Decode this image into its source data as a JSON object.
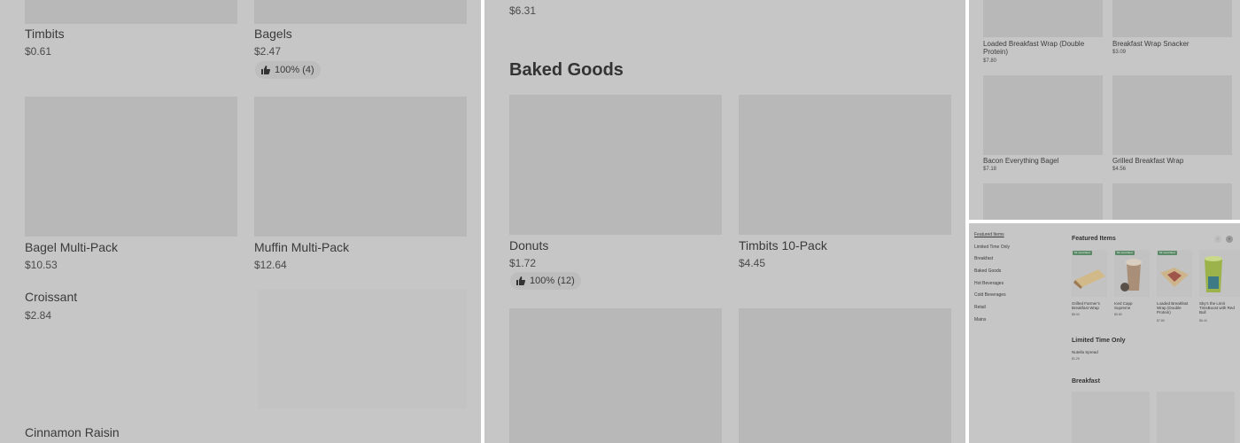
{
  "panel1": {
    "items": [
      {
        "name": "Timbits",
        "price": "$0.61"
      },
      {
        "name": "Bagels",
        "price": "$2.47",
        "rating": "100% (4)"
      },
      {
        "name": "Bagel Multi-Pack",
        "price": "$10.53"
      },
      {
        "name": "Muffin Multi-Pack",
        "price": "$12.64"
      },
      {
        "name": "Croissant",
        "price": "$2.84"
      },
      {
        "name": "Cinnamon Raisin"
      }
    ]
  },
  "panel2": {
    "top_price": "$6.31",
    "section_title": "Baked Goods",
    "items": [
      {
        "name": "Donuts",
        "price": "$1.72",
        "rating": "100% (12)"
      },
      {
        "name": "Timbits 10-Pack",
        "price": "$4.45"
      }
    ]
  },
  "panel3": {
    "items": [
      {
        "name": "Loaded Breakfast Wrap (Double Protein)",
        "price": "$7.80"
      },
      {
        "name": "Breakfast Wrap Snacker",
        "price": "$3.09"
      },
      {
        "name": "Bacon Everything Bagel",
        "price": "$7.18"
      },
      {
        "name": "Grilled Breakfast Wrap",
        "price": "$4.56"
      }
    ]
  },
  "panel4": {
    "nav": [
      "Featured Items",
      "Limited Time Only",
      "Breakfast",
      "Baked Goods",
      "Hot Beverages",
      "Cold Beverages",
      "Retail",
      "Mains"
    ],
    "featured_title": "Featured Items",
    "featured": [
      {
        "name": "Grilled Farmer's Breakfast Wrap",
        "price": "$5.94",
        "badge": "#1 most liked"
      },
      {
        "name": "Iced Capp Supreme",
        "price": "$5.80",
        "badge": "#3 most liked"
      },
      {
        "name": "Loaded Breakfast Wrap (Double Protein)",
        "price": "$7.80",
        "badge": "#2 most liked"
      },
      {
        "name": "Sky's the Limit TimsBoost with Red Bull",
        "price": "$6.44"
      }
    ],
    "limited_title": "Limited Time Only",
    "limited_item": {
      "name": "Nutella Spread",
      "price": "$1.29"
    },
    "breakfast_title": "Breakfast",
    "colors": {
      "badge": "#5b8a68",
      "background": "#c6c6c6"
    }
  }
}
